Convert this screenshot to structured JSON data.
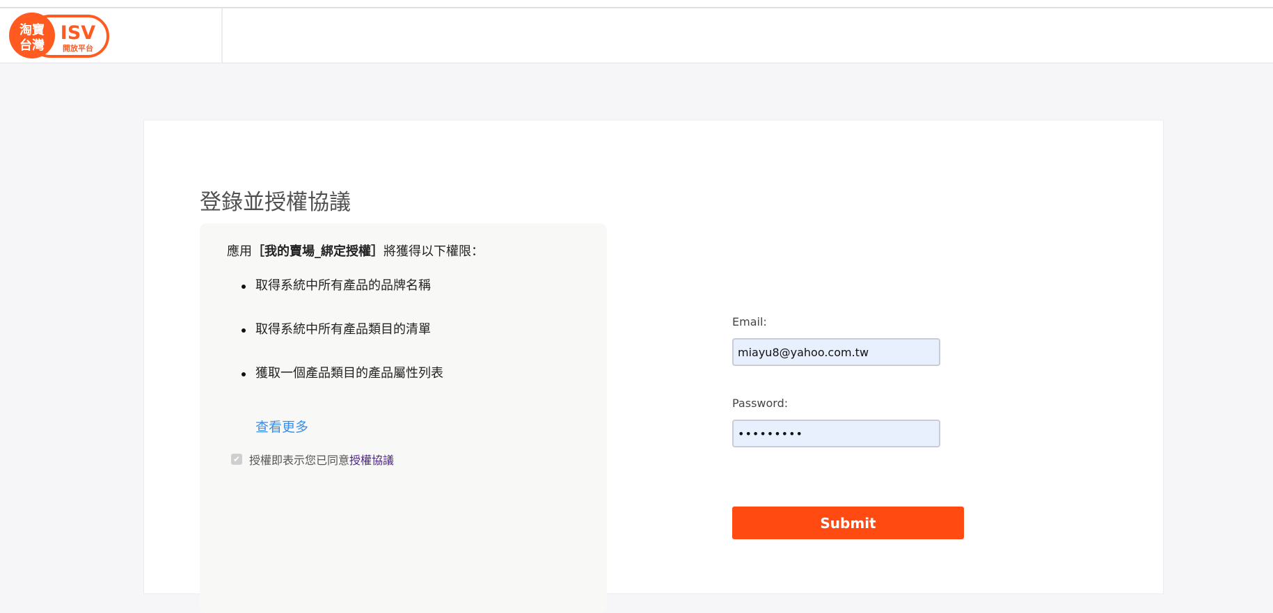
{
  "header": {
    "logo": {
      "line1": "淘寶",
      "line2": "台灣",
      "brand": "ISV",
      "sub": "開放平台",
      "color": "#ff5a1f"
    }
  },
  "main": {
    "title": "登錄並授權協議",
    "permissions": {
      "intro_prefix": "應用",
      "app_name": "［我的賣場_綁定授權］",
      "intro_suffix": "將獲得以下權限：",
      "items": [
        "取得系統中所有產品的品牌名稱",
        "取得系統中所有產品類目的清單",
        "獲取一個產品類目的產品屬性列表"
      ],
      "more_label": "查看更多",
      "agree_text": "授權即表示您已同意",
      "agree_link": "授權協議",
      "agree_checked": true
    },
    "form": {
      "email_label": "Email:",
      "email_value": "miayu8@yahoo.com.tw",
      "password_label": "Password:",
      "password_value": "•••••••••",
      "submit_label": "Submit"
    }
  },
  "colors": {
    "accent": "#ff4b12",
    "link": "#3b8ee8",
    "agree_link": "#4b1f87",
    "background": "#f6f6f9"
  }
}
